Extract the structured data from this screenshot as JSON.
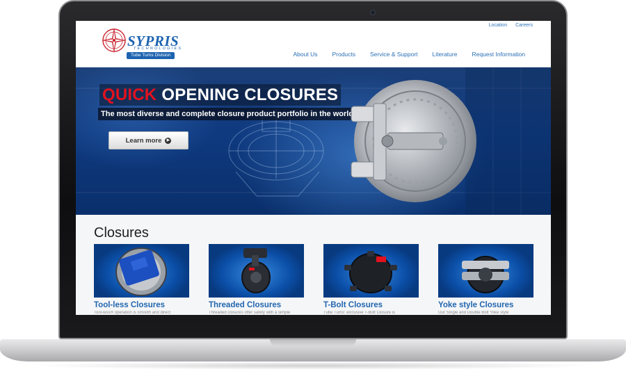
{
  "brand": {
    "name": "SYPRIS",
    "sub": "TECHNOLOGIES",
    "division": "Tube Turns Division",
    "logo_color": "#1d63b0"
  },
  "util_nav": [
    "Location",
    "Careers"
  ],
  "main_nav": [
    "About Us",
    "Products",
    "Service & Support",
    "Literature",
    "Request Information"
  ],
  "hero": {
    "title_accent": "QUICK",
    "title_rest": "OPENING CLOSURES",
    "subtitle": "The most diverse and complete closure product portfolio in the world",
    "button_label": "Learn more",
    "accent_color": "#e2121e"
  },
  "section": {
    "title": "Closures",
    "cards": [
      {
        "title": "Tool-less Closures",
        "desc": "Tool-less® operation is smooth and direct"
      },
      {
        "title": "Threaded Closures",
        "desc": "Threaded closures offer safety with a simple"
      },
      {
        "title": "T-Bolt Closures",
        "desc": "Tube Turns' exclusive T-Bolt Closure is"
      },
      {
        "title": "Yoke style Closures",
        "desc": "Our Single and Double Bolt Yoke style"
      }
    ]
  }
}
